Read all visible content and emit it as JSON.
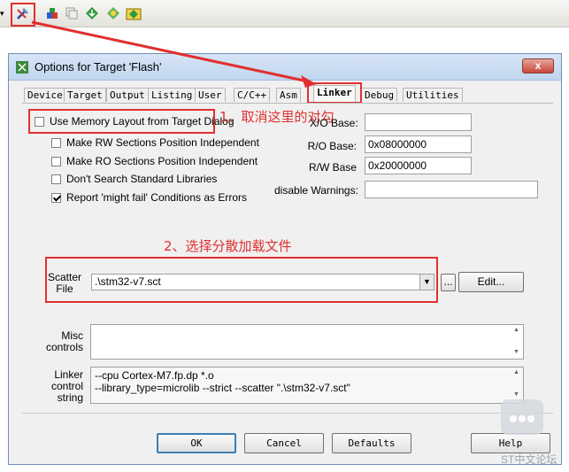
{
  "window": {
    "title": "Options for Target 'Flash'",
    "close_label": "x"
  },
  "toolbar": {
    "icons": [
      "options-for-target-icon",
      "load-icon",
      "copy-icon",
      "download-icon",
      "manage-components-icon",
      "select-packs-icon"
    ]
  },
  "tabs": [
    {
      "label": "Device"
    },
    {
      "label": "Target"
    },
    {
      "label": "Output"
    },
    {
      "label": "Listing"
    },
    {
      "label": "User"
    },
    {
      "label": "C/C++"
    },
    {
      "label": "Asm"
    },
    {
      "label": "Linker",
      "active": true
    },
    {
      "label": "Debug"
    },
    {
      "label": "Utilities"
    }
  ],
  "linker": {
    "use_memory_layout": {
      "label": "Use Memory Layout from Target Dialog",
      "checked": false
    },
    "rw_independent": {
      "label": "Make RW Sections Position Independent",
      "checked": false
    },
    "ro_independent": {
      "label": "Make RO Sections Position Independent",
      "checked": false
    },
    "no_std_libs": {
      "label": "Don't Search Standard Libraries",
      "checked": false
    },
    "might_fail": {
      "label": "Report 'might fail' Conditions as Errors",
      "checked": true
    },
    "xo_base": {
      "label": "X/O Base:",
      "value": ""
    },
    "ro_base": {
      "label": "R/O Base:",
      "value": "0x08000000"
    },
    "rw_base": {
      "label": "R/W Base",
      "value": "0x20000000"
    },
    "disable_warnings": {
      "label": "disable Warnings:",
      "value": ""
    },
    "scatter": {
      "label_line1": "Scatter",
      "label_line2": "File",
      "value": ".\\stm32-v7.sct",
      "browse_label": "...",
      "edit_label": "Edit..."
    },
    "misc": {
      "label_line1": "Misc",
      "label_line2": "controls",
      "value": ""
    },
    "linker_control": {
      "label_line1": "Linker",
      "label_line2": "control",
      "label_line3": "string",
      "line1": "--cpu Cortex-M7.fp.dp *.o",
      "line2": "--library_type=microlib --strict --scatter \".\\stm32-v7.sct\""
    }
  },
  "annotations": {
    "step1": "1、取消这里的对勾",
    "step2": "2、选择分散加载文件"
  },
  "buttons": {
    "ok": "OK",
    "cancel": "Cancel",
    "defaults": "Defaults",
    "help": "Help"
  },
  "watermark": {
    "text": "ST中文论坛"
  },
  "colors": {
    "annotation_red": "#e03030",
    "title_bar": "#c0d6ef"
  }
}
